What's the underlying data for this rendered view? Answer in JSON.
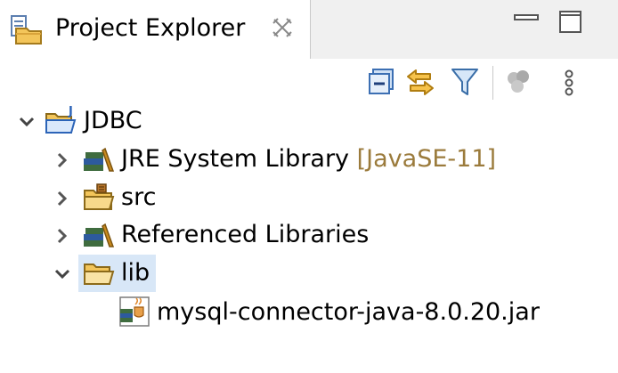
{
  "view": {
    "title": "Project Explorer",
    "tab_icon": "project-explorer-icon",
    "close_icon": "close-icon",
    "minimize_icon": "minimize-icon",
    "maximize_icon": "maximize-icon"
  },
  "toolbar": {
    "items": [
      {
        "name": "collapse-all",
        "icon": "collapse-all-icon"
      },
      {
        "name": "link-with-editor",
        "icon": "link-with-editor-icon"
      },
      {
        "name": "filter",
        "icon": "filter-icon"
      },
      {
        "name": "select-working-set",
        "icon": "working-set-icon",
        "disabled": true
      },
      {
        "name": "view-menu",
        "icon": "view-menu-icon"
      }
    ]
  },
  "tree": {
    "project": {
      "label": "JDBC",
      "expanded": true,
      "icon": "java-project-icon"
    },
    "children": [
      {
        "label": "JRE System Library",
        "decoration": "[JavaSE-11]",
        "expanded": false,
        "icon": "library-icon"
      },
      {
        "label": "src",
        "expanded": false,
        "icon": "source-folder-icon"
      },
      {
        "label": "Referenced Libraries",
        "expanded": false,
        "icon": "library-icon"
      },
      {
        "label": "lib",
        "expanded": true,
        "selected": true,
        "icon": "folder-icon"
      }
    ],
    "lib_children": [
      {
        "label": "mysql-connector-java-8.0.20.jar",
        "icon": "jar-icon"
      }
    ]
  },
  "colors": {
    "selection": "#d8e7f7",
    "decoration": "#9b7b3c",
    "header": "#f0f0f0"
  }
}
